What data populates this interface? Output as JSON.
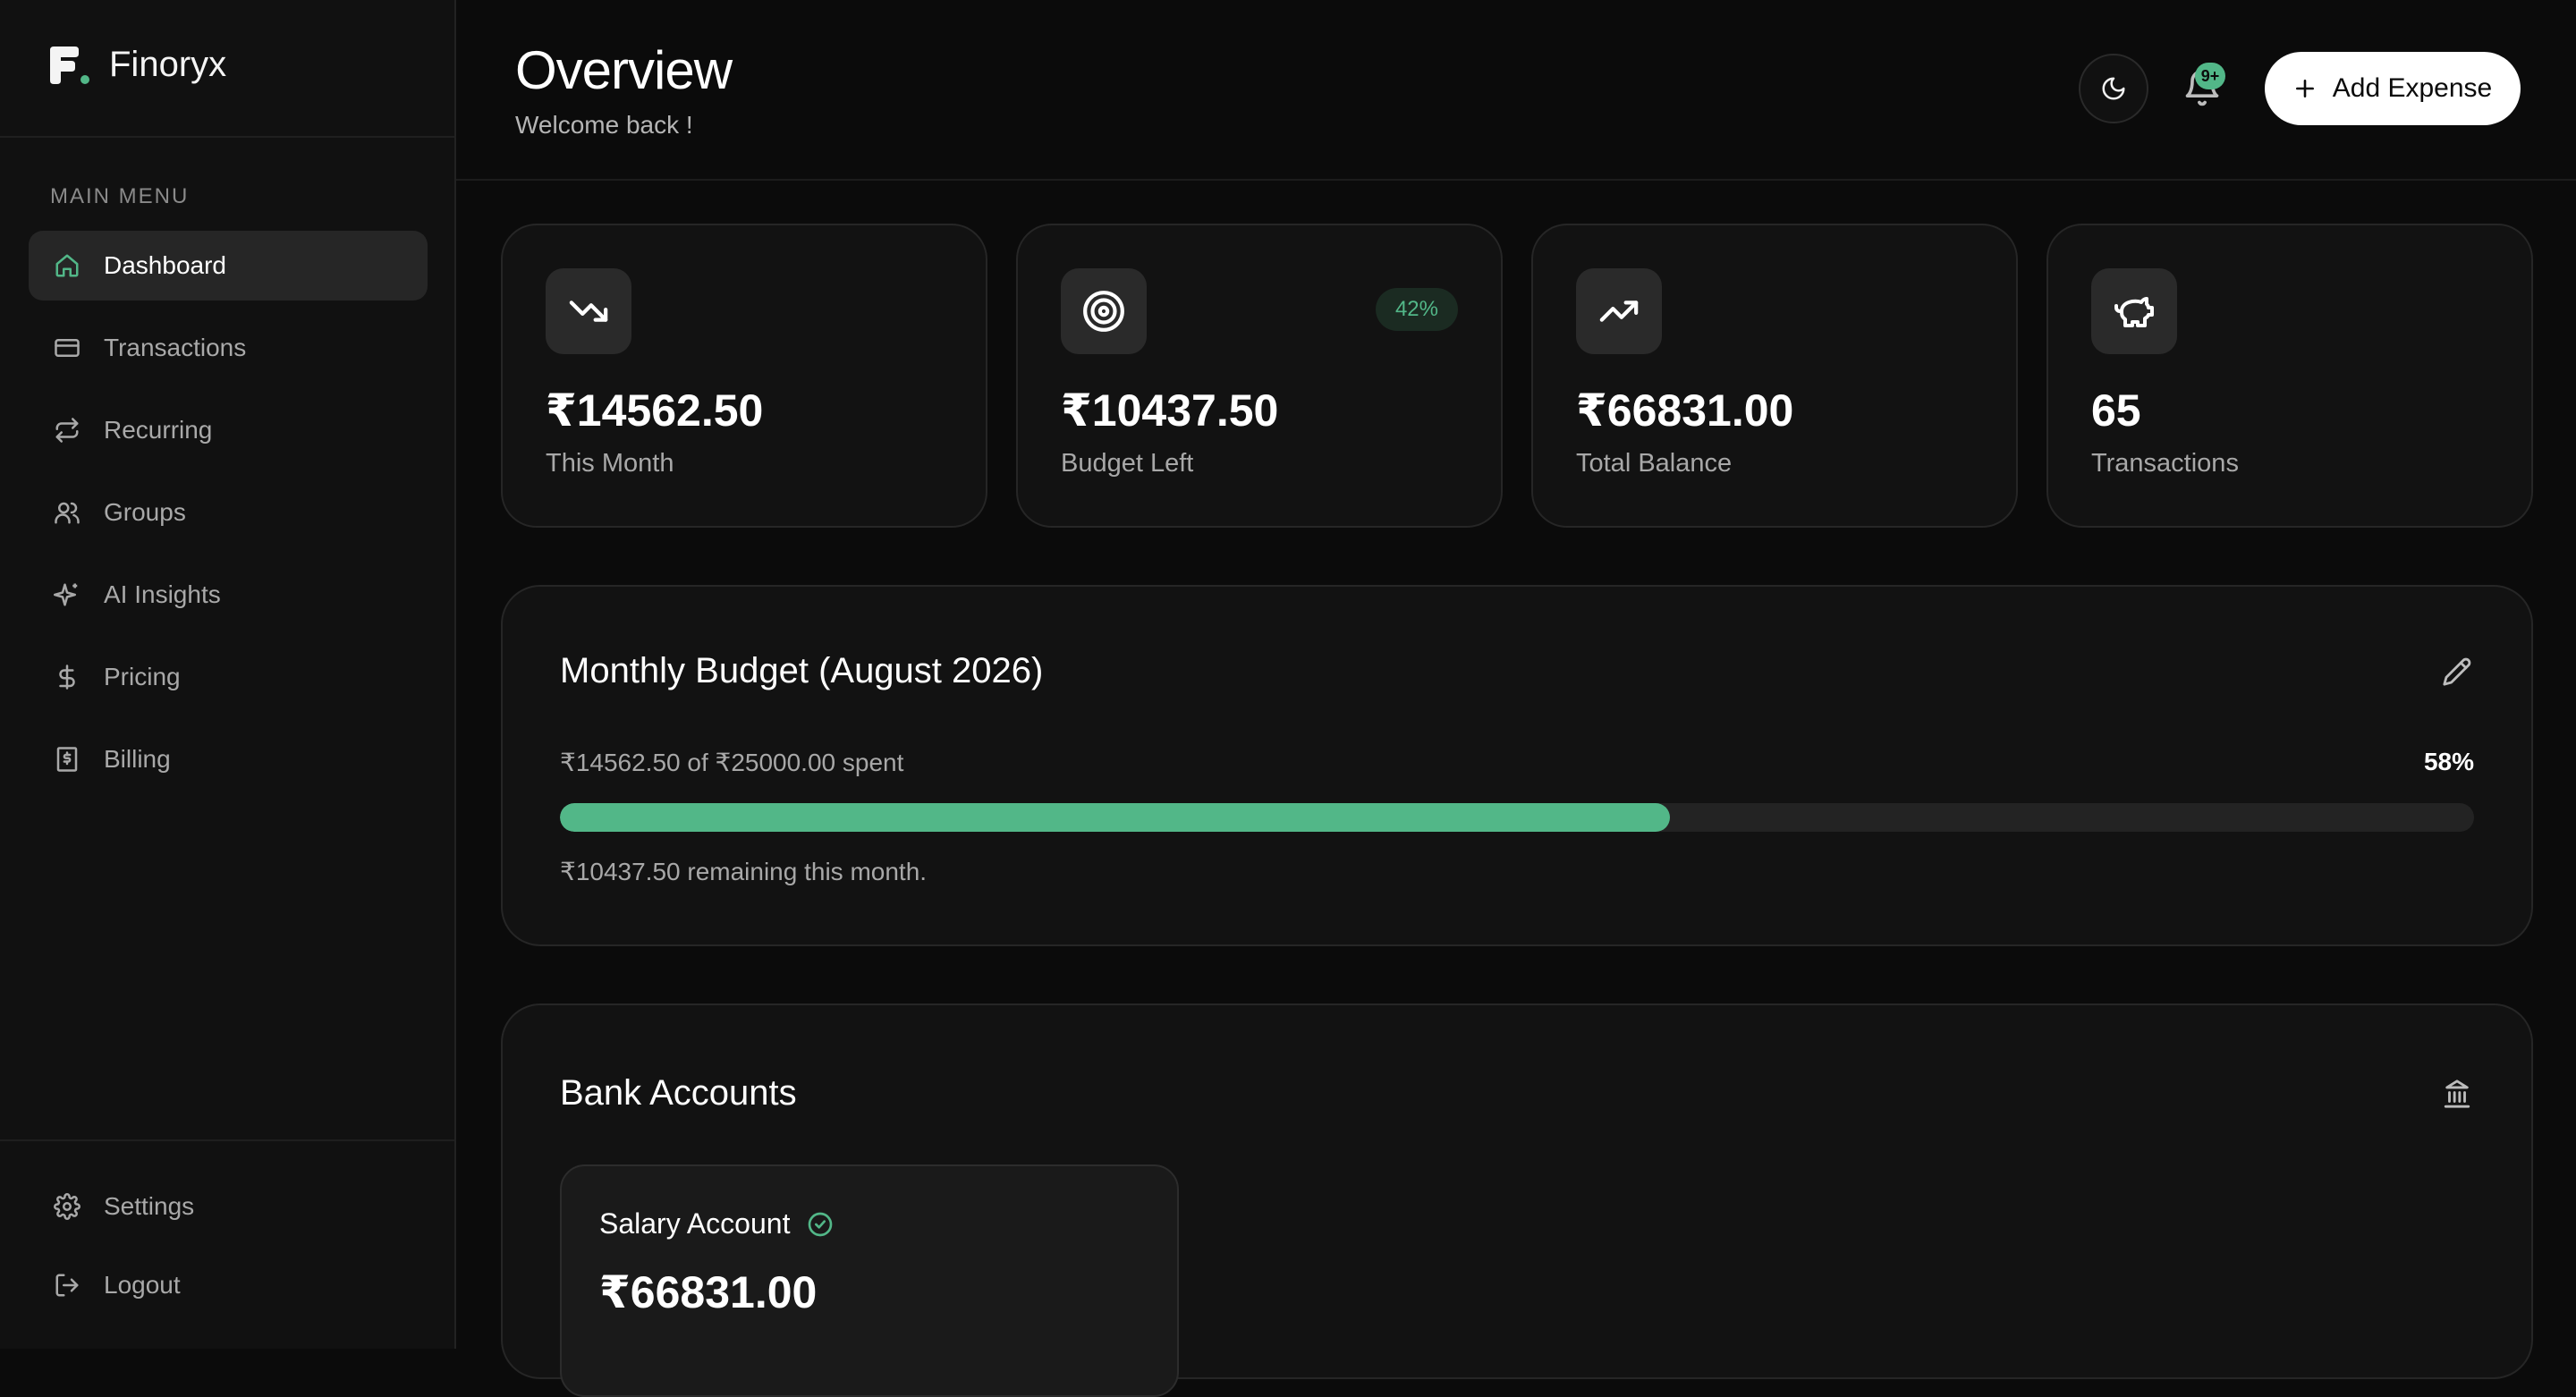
{
  "app": {
    "name": "Finoryx"
  },
  "sidebar": {
    "heading": "MAIN MENU",
    "items": [
      {
        "label": "Dashboard",
        "icon": "home-icon",
        "active": true
      },
      {
        "label": "Transactions",
        "icon": "credit-card-icon"
      },
      {
        "label": "Recurring",
        "icon": "repeat-icon"
      },
      {
        "label": "Groups",
        "icon": "users-icon"
      },
      {
        "label": "AI Insights",
        "icon": "sparkles-icon"
      },
      {
        "label": "Pricing",
        "icon": "dollar-icon"
      },
      {
        "label": "Billing",
        "icon": "receipt-icon"
      }
    ],
    "bottom": [
      {
        "label": "Settings",
        "icon": "gear-icon"
      },
      {
        "label": "Logout",
        "icon": "logout-icon"
      }
    ]
  },
  "header": {
    "title": "Overview",
    "subtitle": "Welcome back !",
    "notification_badge": "9+",
    "add_button": "Add Expense"
  },
  "stats": [
    {
      "value": "₹14562.50",
      "label": "This Month",
      "icon": "trending-down-icon"
    },
    {
      "value": "₹10437.50",
      "label": "Budget Left",
      "icon": "target-icon",
      "badge": "42%"
    },
    {
      "value": "₹66831.00",
      "label": "Total Balance",
      "icon": "trending-up-icon"
    },
    {
      "value": "65",
      "label": "Transactions",
      "icon": "piggy-bank-icon"
    }
  ],
  "budget": {
    "title": "Monthly Budget (August 2026)",
    "spent_text": "₹14562.50 of ₹25000.00 spent",
    "percent": "58%",
    "progress": 0.58,
    "remaining_text": "₹10437.50 remaining this month."
  },
  "bank": {
    "title": "Bank Accounts",
    "accounts": [
      {
        "name": "Salary Account",
        "balance": "₹66831.00",
        "verified": true
      }
    ]
  },
  "colors": {
    "accent": "#52b788",
    "background": "#0b0b0b",
    "card": "#121212"
  }
}
